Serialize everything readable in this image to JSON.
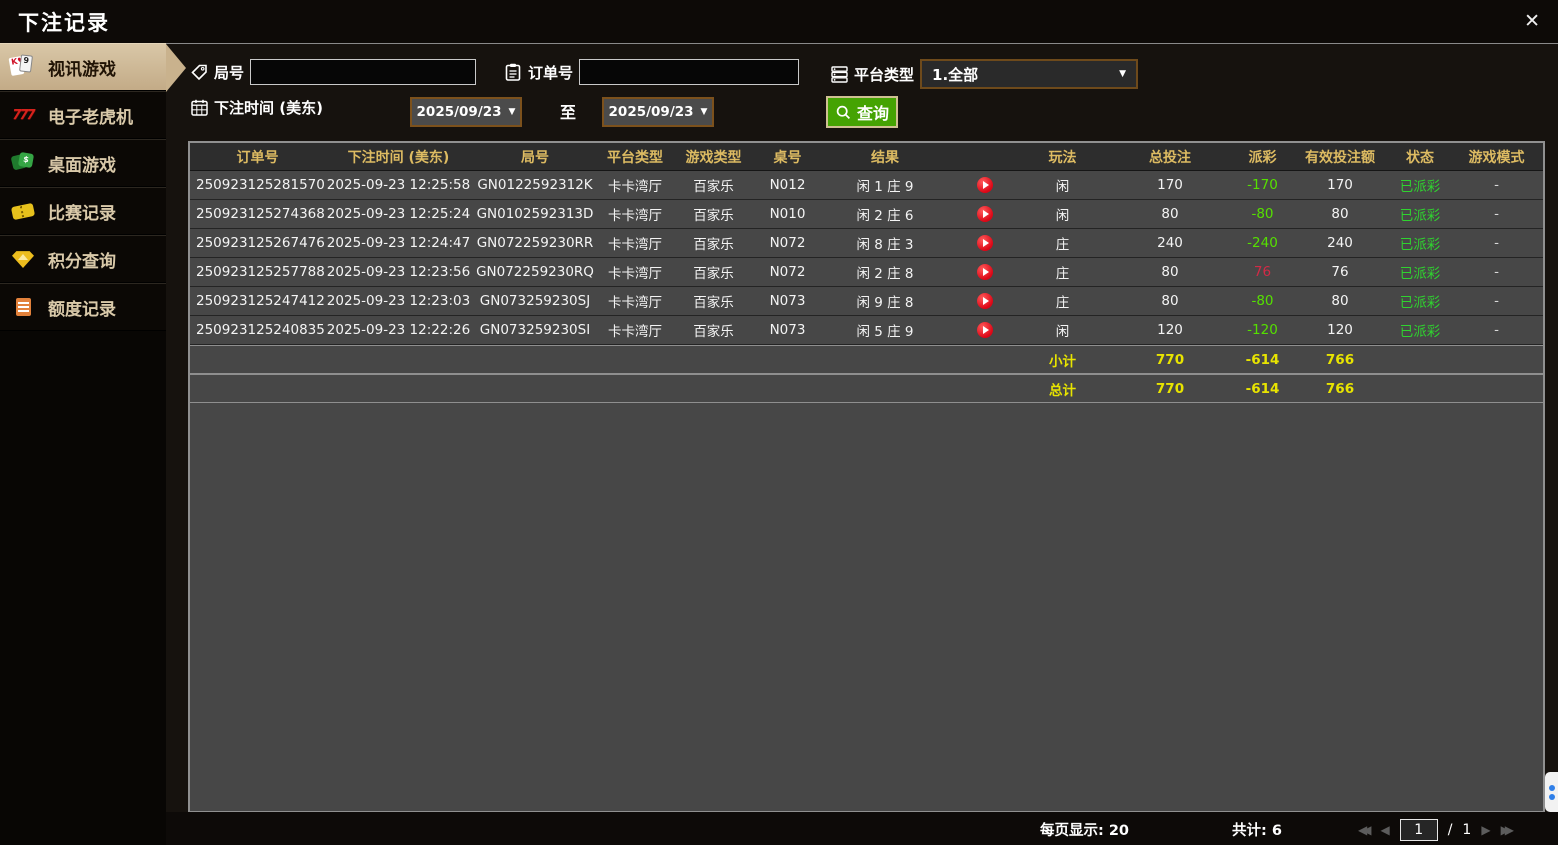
{
  "window": {
    "title": "下注记录",
    "close_icon": "✕"
  },
  "sidebar": {
    "items": [
      {
        "label": "视讯游戏",
        "icon": "playing-cards-icon",
        "active": true
      },
      {
        "label": "电子老虎机",
        "icon": "slot-777-icon",
        "active": false
      },
      {
        "label": "桌面游戏",
        "icon": "table-games-icon",
        "active": false
      },
      {
        "label": "比赛记录",
        "icon": "ticket-icon",
        "active": false
      },
      {
        "label": "积分查询",
        "icon": "gem-icon",
        "active": false
      },
      {
        "label": "额度记录",
        "icon": "document-icon",
        "active": false
      }
    ]
  },
  "filters": {
    "round_label": "局号",
    "order_label": "订单号",
    "platform_label": "平台类型",
    "platform_value": "1.全部",
    "bet_time_label": "下注时间 (美东)",
    "date_from": "2025/09/23",
    "date_to": "2025/09/23",
    "to_label": "至",
    "search_label": "查询",
    "caret": "▼"
  },
  "table": {
    "headers": [
      "订单号",
      "下注时间 (美东)",
      "局号",
      "平台类型",
      "游戏类型",
      "桌号",
      "结果",
      "玩法",
      "总投注",
      "派彩",
      "有效投注额",
      "状态",
      "游戏模式"
    ],
    "rows": [
      {
        "order": "250923125281570",
        "time": "2025-09-23 12:25:58",
        "round": "GN0122592312K",
        "platform": "卡卡湾厅",
        "game": "百家乐",
        "table_no": "N012",
        "result": "闲 1 庄 9",
        "bet_type": "闲",
        "total_bet": "170",
        "payout": "-170",
        "payout_tone": "green",
        "valid_bet": "170",
        "status": "已派彩",
        "mode": "-"
      },
      {
        "order": "250923125274368",
        "time": "2025-09-23 12:25:24",
        "round": "GN0102592313D",
        "platform": "卡卡湾厅",
        "game": "百家乐",
        "table_no": "N010",
        "result": "闲 2 庄 6",
        "bet_type": "闲",
        "total_bet": "80",
        "payout": "-80",
        "payout_tone": "green",
        "valid_bet": "80",
        "status": "已派彩",
        "mode": "-"
      },
      {
        "order": "250923125267476",
        "time": "2025-09-23 12:24:47",
        "round": "GN072259230RR",
        "platform": "卡卡湾厅",
        "game": "百家乐",
        "table_no": "N072",
        "result": "闲 8 庄 3",
        "bet_type": "庄",
        "total_bet": "240",
        "payout": "-240",
        "payout_tone": "green",
        "valid_bet": "240",
        "status": "已派彩",
        "mode": "-"
      },
      {
        "order": "250923125257788",
        "time": "2025-09-23 12:23:56",
        "round": "GN072259230RQ",
        "platform": "卡卡湾厅",
        "game": "百家乐",
        "table_no": "N072",
        "result": "闲 2 庄 8",
        "bet_type": "庄",
        "total_bet": "80",
        "payout": "76",
        "payout_tone": "red",
        "valid_bet": "76",
        "status": "已派彩",
        "mode": "-"
      },
      {
        "order": "250923125247412",
        "time": "2025-09-23 12:23:03",
        "round": "GN073259230SJ",
        "platform": "卡卡湾厅",
        "game": "百家乐",
        "table_no": "N073",
        "result": "闲 9 庄 8",
        "bet_type": "庄",
        "total_bet": "80",
        "payout": "-80",
        "payout_tone": "green",
        "valid_bet": "80",
        "status": "已派彩",
        "mode": "-"
      },
      {
        "order": "250923125240835",
        "time": "2025-09-23 12:22:26",
        "round": "GN073259230SI",
        "platform": "卡卡湾厅",
        "game": "百家乐",
        "table_no": "N073",
        "result": "闲 5 庄 9",
        "bet_type": "闲",
        "total_bet": "120",
        "payout": "-120",
        "payout_tone": "green",
        "valid_bet": "120",
        "status": "已派彩",
        "mode": "-"
      }
    ],
    "subtotal": {
      "label": "小计",
      "total_bet": "770",
      "payout": "-614",
      "valid_bet": "766"
    },
    "total": {
      "label": "总计",
      "total_bet": "770",
      "payout": "-614",
      "valid_bet": "766"
    }
  },
  "footer": {
    "per_page": "每页显示: 20",
    "total_count": "共计: 6",
    "page": "1",
    "slash": "/",
    "total_pages": "1"
  },
  "colors": {
    "payout_loss_green": "#55e000",
    "payout_win_red": "#d22a47",
    "status_paid_green": "#2fd32f",
    "summary_yellow": "#e8e400",
    "header_gold": "#ddbb62",
    "search_button_green": "#45a303",
    "active_tab_tan": "#cdb792"
  }
}
